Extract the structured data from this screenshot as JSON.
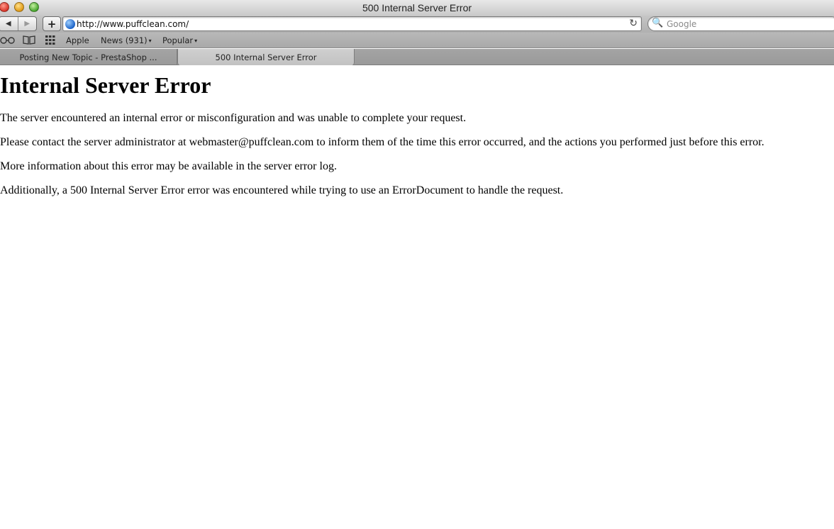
{
  "window": {
    "title": "500 Internal Server Error"
  },
  "toolbar": {
    "back_glyph": "◀",
    "forward_glyph": "▶",
    "add_glyph": "+",
    "url": "http://www.puffclean.com/",
    "search_placeholder": "Google",
    "reload_glyph": "↻",
    "search_glyph": "🔍"
  },
  "bookmarks": {
    "items": [
      {
        "label": "Apple",
        "has_menu": false
      },
      {
        "label": "News (931)",
        "has_menu": true
      },
      {
        "label": "Popular",
        "has_menu": true
      }
    ],
    "caret": "▾"
  },
  "tabs": [
    {
      "label": "Posting New Topic - PrestaShop ...",
      "active": false
    },
    {
      "label": "500 Internal Server Error",
      "active": true
    }
  ],
  "page": {
    "heading": "Internal Server Error",
    "paragraphs": [
      "The server encountered an internal error or misconfiguration and was unable to complete your request.",
      "Please contact the server administrator at webmaster@puffclean.com to inform them of the time this error occurred, and the actions you performed just before this error.",
      "More information about this error may be available in the server error log.",
      "Additionally, a 500 Internal Server Error error was encountered while trying to use an ErrorDocument to handle the request."
    ]
  },
  "icons": {
    "reading_list": "reading-list-icon",
    "bookmarks": "bookmarks-icon",
    "top_sites": "top-sites-icon",
    "globe": "globe-icon"
  }
}
